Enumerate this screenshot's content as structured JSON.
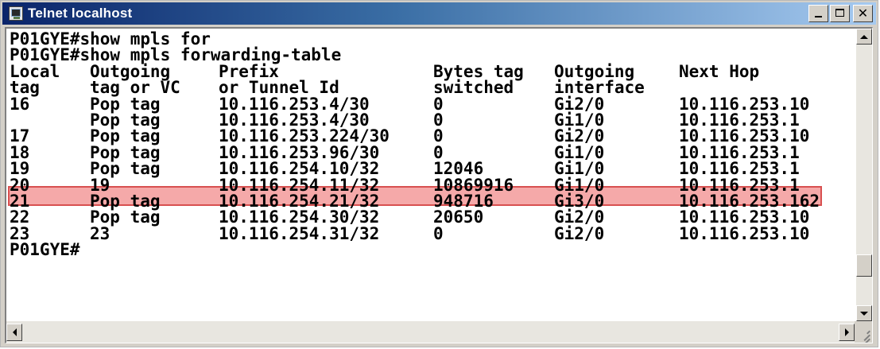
{
  "window": {
    "title": "Telnet localhost",
    "icon": "telnet-terminal-icon"
  },
  "title_buttons": {
    "minimize_icon": "minimize-icon",
    "maximize_icon": "maximize-icon",
    "close_label": "✕"
  },
  "console": {
    "commands": [
      "P01GYE#show mpls for",
      "P01GYE#show mpls forwarding-table"
    ],
    "headers": [
      [
        "Local",
        "Outgoing",
        "Prefix",
        "Bytes tag",
        "Outgoing",
        "Next Hop"
      ],
      [
        "tag",
        "tag or VC",
        "or Tunnel Id",
        "switched",
        "interface",
        ""
      ]
    ],
    "rows": [
      [
        "16",
        "Pop tag",
        "10.116.253.4/30",
        "0",
        "Gi2/0",
        "10.116.253.10"
      ],
      [
        "",
        "Pop tag",
        "10.116.253.4/30",
        "0",
        "Gi1/0",
        "10.116.253.1"
      ],
      [
        "17",
        "Pop tag",
        "10.116.253.224/30",
        "0",
        "Gi2/0",
        "10.116.253.10"
      ],
      [
        "18",
        "Pop tag",
        "10.116.253.96/30",
        "0",
        "Gi1/0",
        "10.116.253.1"
      ],
      [
        "19",
        "Pop tag",
        "10.116.254.10/32",
        "12046",
        "Gi1/0",
        "10.116.253.1"
      ],
      [
        "20",
        "19",
        "10.116.254.11/32",
        "10869916",
        "Gi1/0",
        "10.116.253.1"
      ],
      [
        "21",
        "Pop tag",
        "10.116.254.21/32",
        "948716",
        "Gi3/0",
        "10.116.253.162"
      ],
      [
        "22",
        "Pop tag",
        "10.116.254.30/32",
        "20650",
        "Gi2/0",
        "10.116.253.10"
      ],
      [
        "23",
        "23",
        "10.116.254.31/32",
        "0",
        "Gi2/0",
        "10.116.253.10"
      ]
    ],
    "prompt": "P01GYE#",
    "highlighted_row_index": 5,
    "highlight_color": "#f5a9a9",
    "highlight_border_color": "#d85050"
  },
  "colors": {
    "titlebar_start": "#0a246a",
    "titlebar_end": "#a6caf0",
    "console_bg": "#ffffff",
    "console_text": "#000000"
  }
}
